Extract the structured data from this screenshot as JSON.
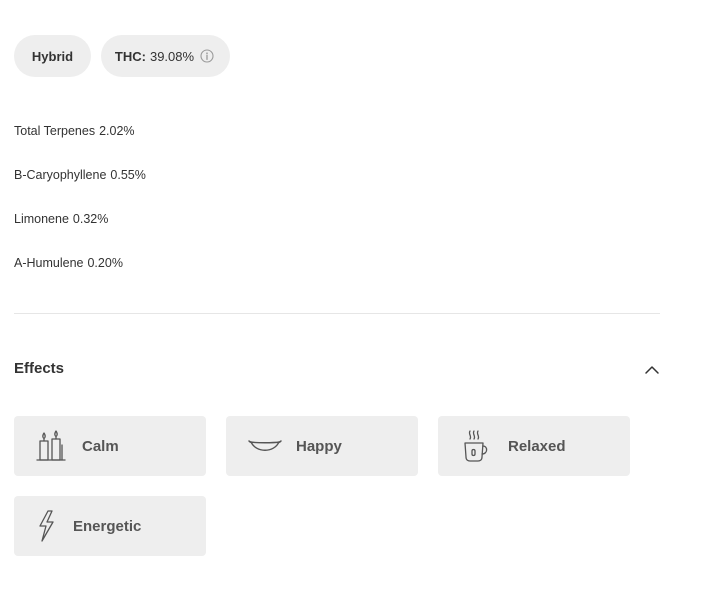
{
  "strain_pill": {
    "label": "Hybrid"
  },
  "thc_pill": {
    "label": "THC:",
    "value": "39.08%",
    "icon": "info-icon"
  },
  "terpenes": [
    {
      "name": "Total Terpenes",
      "value": "2.02%"
    },
    {
      "name": "B-Caryophyllene",
      "value": "0.55%"
    },
    {
      "name": "Limonene",
      "value": "0.32%"
    },
    {
      "name": "A-Humulene",
      "value": "0.20%"
    }
  ],
  "effects_section": {
    "title": "Effects",
    "toggle_icon": "chevron-up-icon",
    "items": [
      {
        "label": "Calm",
        "icon": "candles-icon"
      },
      {
        "label": "Happy",
        "icon": "smile-icon"
      },
      {
        "label": "Relaxed",
        "icon": "coffee-cup-icon"
      },
      {
        "label": "Energetic",
        "icon": "lightning-bolt-icon"
      }
    ]
  },
  "colors": {
    "pill_bg": "#eeeeee",
    "text": "#333333",
    "effect_label": "#555555",
    "divider": "#e6e6e6"
  }
}
